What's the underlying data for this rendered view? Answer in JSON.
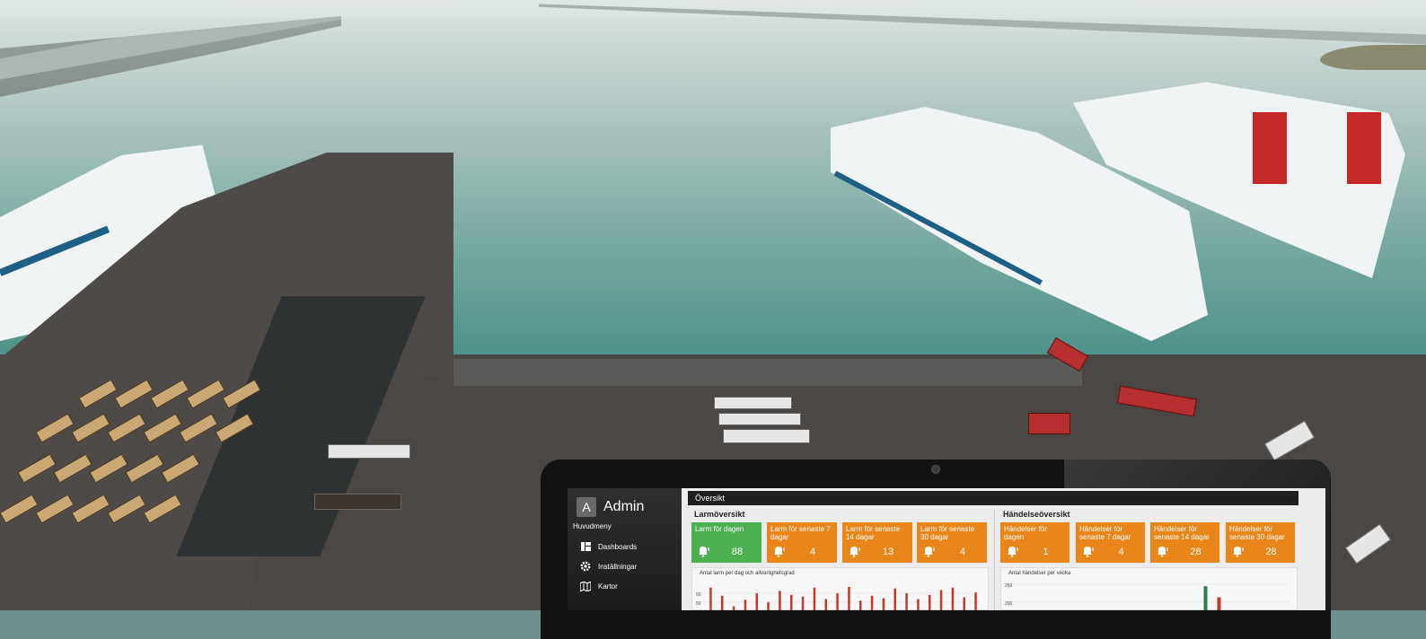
{
  "colors": {
    "ok": "#4caf50",
    "warning": "#e8861a",
    "chart_bar": "#c0392b",
    "chart_bar_alt": "#2e7d4f"
  },
  "app": {
    "user": {
      "initial": "A",
      "name": "Admin"
    },
    "menu_title": "Huvudmeny",
    "menu": [
      {
        "label": "Dashboards",
        "icon": "dashboard-icon"
      },
      {
        "label": "Inställningar",
        "icon": "gear-icon"
      },
      {
        "label": "Kartor",
        "icon": "map-icon"
      }
    ],
    "topbar_title": "Översikt",
    "alarms": {
      "title": "Larmöversikt",
      "cards": [
        {
          "label": "Larm för dagen",
          "value": "88",
          "status": "ok"
        },
        {
          "label": "Larm för senaste 7 dagar",
          "value": "4",
          "status": "warning"
        },
        {
          "label": "Larm för senaste 14 dagar",
          "value": "13",
          "status": "warning"
        },
        {
          "label": "Larm för senaste 30 dagar",
          "value": "4",
          "status": "warning"
        }
      ],
      "chart_title": "Antal larm per dag och allvarlighetsgrad",
      "chart_ticks": [
        "60",
        "50"
      ]
    },
    "events": {
      "title": "Händelseöversikt",
      "cards": [
        {
          "label": "Händelser för dagen",
          "value": "1",
          "status": "warning"
        },
        {
          "label": "Händelser för senaste 7 dagar",
          "value": "4",
          "status": "warning"
        },
        {
          "label": "Händelser för senaste 14 dagar",
          "value": "28",
          "status": "warning"
        },
        {
          "label": "Händelser för senaste 30 dagar",
          "value": "28",
          "status": "warning"
        }
      ],
      "chart_title": "Antal händelser per vecka",
      "chart_ticks": [
        "250",
        "200"
      ]
    }
  },
  "chart_data": [
    {
      "type": "bar",
      "title": "Antal larm per dag och allvarlighetsgrad",
      "y_ticks": [
        60,
        50
      ],
      "values": [
        58,
        38,
        12,
        28,
        44,
        22,
        50,
        40,
        36,
        58,
        30,
        44,
        60,
        26,
        38,
        32,
        56,
        44,
        30,
        40,
        52,
        58,
        34,
        46
      ]
    },
    {
      "type": "bar",
      "title": "Antal händelser per vecka",
      "y_ticks": [
        250,
        200
      ],
      "values": [
        240,
        200
      ]
    }
  ]
}
